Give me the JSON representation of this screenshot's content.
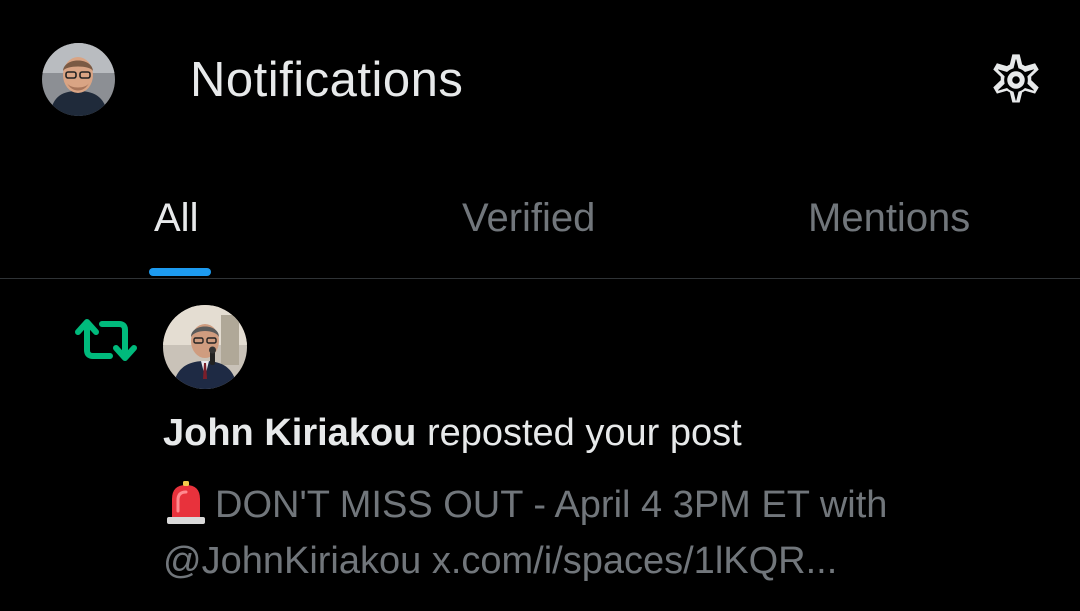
{
  "header": {
    "title": "Notifications",
    "avatar_icon": "user-avatar",
    "settings_icon": "gear-icon"
  },
  "tabs": [
    {
      "label": "All",
      "active": true
    },
    {
      "label": "Verified",
      "active": false
    },
    {
      "label": "Mentions",
      "active": false
    }
  ],
  "notification": {
    "type_icon": "repost-icon",
    "actor": "John Kiriakou",
    "action": "reposted your post",
    "preview_emoji": "siren-icon",
    "preview_line1": "DON'T MISS OUT - April 4 3PM ET with",
    "preview_line2": "@JohnKiriakou x.com/i/spaces/1lKQR..."
  },
  "colors": {
    "background": "#000000",
    "text": "#e7e9ea",
    "muted": "#71767b",
    "accent": "#1d9bf0",
    "repost": "#00ba7c",
    "divider": "#2f3336"
  }
}
